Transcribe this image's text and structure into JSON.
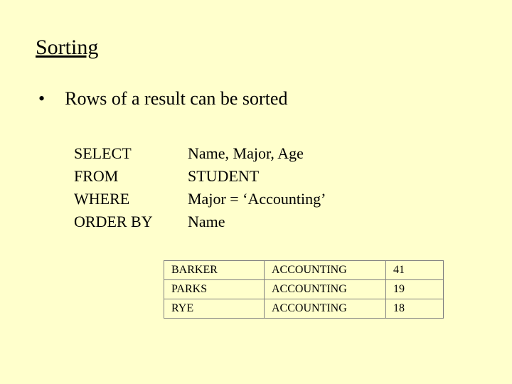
{
  "title": "Sorting",
  "bullet": "Rows of a result can be sorted",
  "sql": {
    "select_kw": "SELECT",
    "select_val": "Name, Major, Age",
    "from_kw": "FROM",
    "from_val": "STUDENT",
    "where_kw": "WHERE",
    "where_val": "Major = ‘Accounting’",
    "orderby_kw": "ORDER BY",
    "orderby_val": "Name"
  },
  "table": {
    "rows": [
      {
        "name": "BARKER",
        "major": "ACCOUNTING",
        "age": "41"
      },
      {
        "name": "PARKS",
        "major": "ACCOUNTING",
        "age": "19"
      },
      {
        "name": "RYE",
        "major": "ACCOUNTING",
        "age": "18"
      }
    ]
  }
}
